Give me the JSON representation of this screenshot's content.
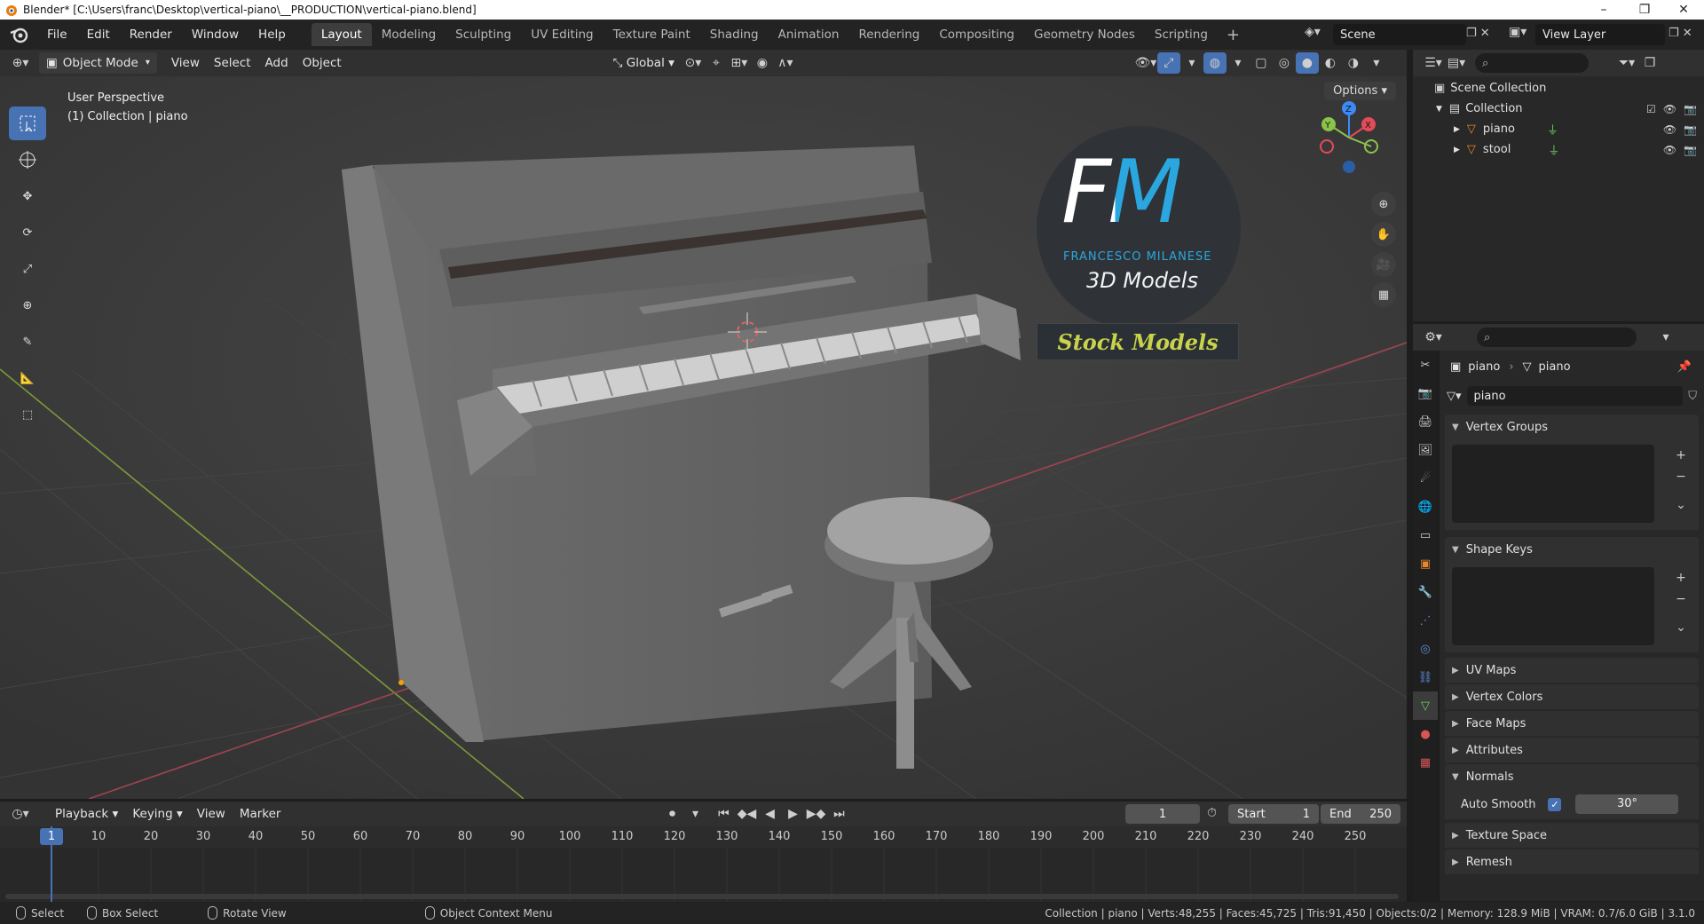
{
  "window": {
    "title": "Blender* [C:\\Users\\franc\\Desktop\\vertical-piano\\__PRODUCTION\\vertical-piano.blend]",
    "minimize": "–",
    "maximize": "❐",
    "close": "✕"
  },
  "menu": {
    "items": [
      "File",
      "Edit",
      "Render",
      "Window",
      "Help"
    ]
  },
  "workspaces": {
    "tabs": [
      "Layout",
      "Modeling",
      "Sculpting",
      "UV Editing",
      "Texture Paint",
      "Shading",
      "Animation",
      "Rendering",
      "Compositing",
      "Geometry Nodes",
      "Scripting"
    ],
    "active": "Layout",
    "add": "+"
  },
  "scene": {
    "name": "Scene"
  },
  "view_layer": {
    "name": "View Layer"
  },
  "viewport_header": {
    "mode": "Object Mode",
    "menus": [
      "View",
      "Select",
      "Add",
      "Object"
    ],
    "orientation": "Global",
    "options": "Options"
  },
  "viewport": {
    "perspective": "User Perspective",
    "collection_info": "(1) Collection | piano"
  },
  "watermark": {
    "logo": "FM",
    "name": "FRANCESCO MILANESE",
    "subtitle": "3D Models",
    "banner": "Stock Models"
  },
  "gizmo": {
    "x": "X",
    "y": "Y",
    "z": "Z"
  },
  "outliner": {
    "scene_collection": "Scene Collection",
    "collection": "Collection",
    "objects": [
      "piano",
      "stool"
    ]
  },
  "properties": {
    "breadcrumb_object": "piano",
    "breadcrumb_data": "piano",
    "mesh_name": "piano",
    "panels": {
      "vertex_groups": "Vertex Groups",
      "shape_keys": "Shape Keys",
      "uv_maps": "UV Maps",
      "vertex_colors": "Vertex Colors",
      "face_maps": "Face Maps",
      "attributes": "Attributes",
      "normals": "Normals",
      "texture_space": "Texture Space",
      "remesh": "Remesh"
    },
    "auto_smooth_label": "Auto Smooth",
    "auto_smooth_angle": "30°"
  },
  "timeline": {
    "menus": [
      "Playback",
      "Keying",
      "View",
      "Marker"
    ],
    "current_frame": "1",
    "start_label": "Start",
    "start": "1",
    "end_label": "End",
    "end": "250",
    "ticks": [
      "1",
      "10",
      "20",
      "30",
      "40",
      "50",
      "60",
      "70",
      "80",
      "90",
      "100",
      "110",
      "120",
      "130",
      "140",
      "150",
      "160",
      "170",
      "180",
      "190",
      "200",
      "210",
      "220",
      "230",
      "240",
      "250"
    ]
  },
  "statusbar": {
    "select": "Select",
    "box_select": "Box Select",
    "rotate_view": "Rotate View",
    "context_menu": "Object Context Menu",
    "stats": "Collection | piano | Verts:48,255 | Faces:45,725 | Tris:91,450 | Objects:0/2 | Memory: 128.9 MiB | VRAM: 0.7/6.0 GiB | 3.1.0"
  },
  "colors": {
    "accent": "#4772b3",
    "watermark_blue": "#2aa7df",
    "watermark_banner": "#c8d24a",
    "axis_x": "#e44b5a",
    "axis_y": "#8bc34a",
    "axis_z": "#3d8af7"
  }
}
